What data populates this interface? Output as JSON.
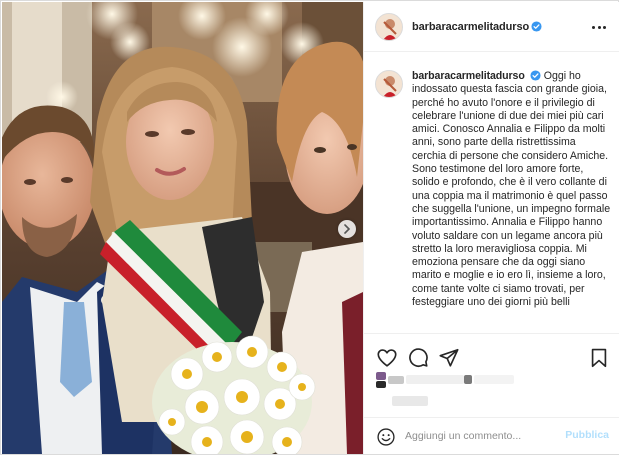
{
  "post": {
    "username": "barbaracarmelitadurso",
    "verified": true,
    "caption": "Oggi ho indossato questa fascia con grande gioia, perché ho avuto l'onore e il privilegio di celebrare l'unione di due dei miei più cari amici. Conosco Annalia e Filippo da molti anni, sono parte della ristrettissima cerchia di persone che considero Amiche. Sono testimone del loro amore forte, solido e profondo, che è il vero collante di una coppia ma il matrimonio è quel passo che suggella l'unione, un impegno formale importantissimo. Annalia e Filippo hanno voluto saldare con un legame ancora più stretto la loro meravigliosa coppia. Mi emoziona pensare che da oggi siano marito e moglie e io ero lì, insieme a loro, come tante volte ci siamo trovati, per festeggiare uno dei giorni più belli"
  },
  "comment_box": {
    "placeholder": "Aggiungi un commento...",
    "publish_label": "Pubblica"
  },
  "icons": {
    "header_more": "more-options-icon",
    "like": "heart-icon",
    "comment": "comment-bubble-icon",
    "share": "paper-plane-icon",
    "save": "bookmark-icon",
    "emoji": "emoji-smile-icon",
    "next": "chevron-right-icon"
  },
  "colors": {
    "verified_blue": "#3897f0",
    "publish_disabled": "#b2dffc",
    "sash_green": "#1f8a3c",
    "sash_white": "#f4f4f0",
    "sash_red": "#c8202a"
  }
}
